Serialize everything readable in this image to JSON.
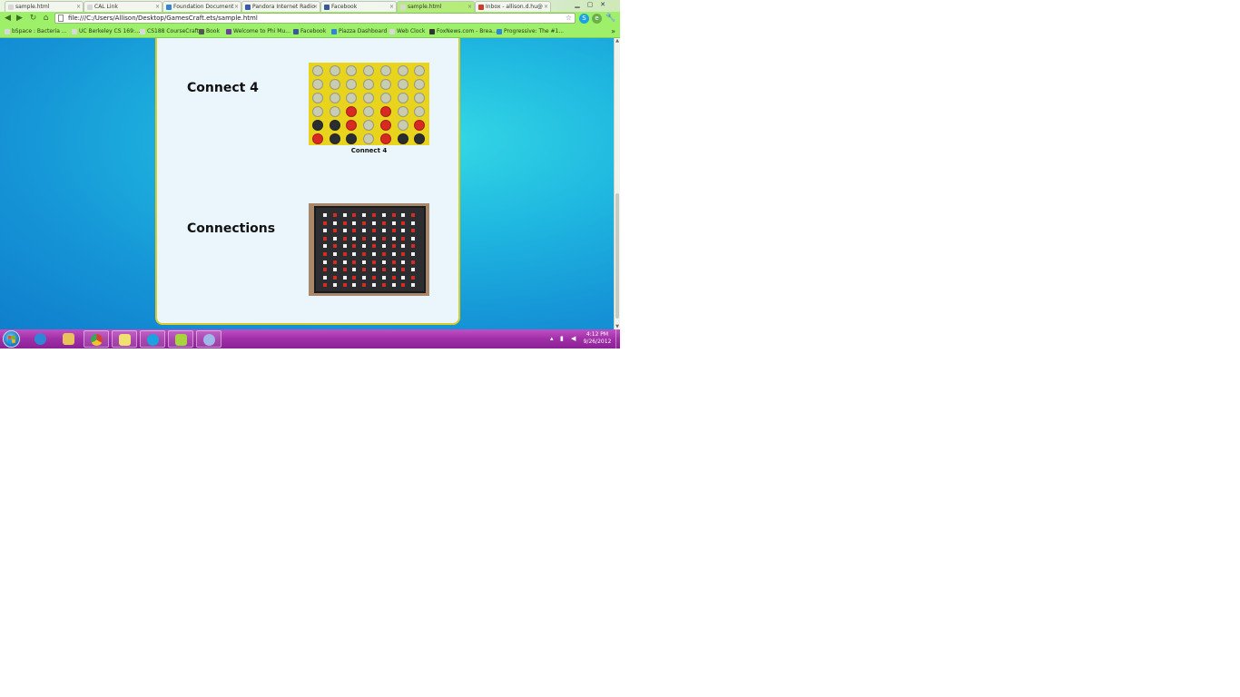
{
  "browser": {
    "tabs": [
      {
        "label": "sample.html",
        "icon_color": "#d8d8d8",
        "active": false
      },
      {
        "label": "CAL Link",
        "icon_color": "#d8d8d8",
        "active": false
      },
      {
        "label": "Foundation Document",
        "icon_color": "#2f86d6",
        "active": false
      },
      {
        "label": "Pandora Internet Radio",
        "icon_color": "#3a5ba8",
        "active": false
      },
      {
        "label": "Facebook",
        "icon_color": "#3b5998",
        "active": false
      },
      {
        "label": "sample.html",
        "icon_color": "#d8d8d8",
        "active": true
      },
      {
        "label": "Inbox - allison.d.hu@",
        "icon_color": "#d23a2a",
        "active": false
      }
    ],
    "address": "file:///C:/Users/Allison/Desktop/GamesCraft.ets/sample.html",
    "window_controls": [
      "minimize",
      "maximize",
      "close"
    ],
    "bookmarks": [
      {
        "label": "bSpace : Bacteria ...",
        "icon_color": "#d8d8d8"
      },
      {
        "label": "UC Berkeley CS 169:...",
        "icon_color": "#d8d8d8"
      },
      {
        "label": "CS188 CourseCraft",
        "icon_color": "#d8d8d8"
      },
      {
        "label": "Book",
        "icon_color": "#555555"
      },
      {
        "label": "Welcome to Phi Mu...",
        "icon_color": "#6a3fa0"
      },
      {
        "label": "Facebook",
        "icon_color": "#3b5998"
      },
      {
        "label": "Piazza Dashboard",
        "icon_color": "#2f86d6"
      },
      {
        "label": "Web Clock",
        "icon_color": "#d8d8d8"
      },
      {
        "label": "FoxNews.com - Brea...",
        "icon_color": "#333333"
      },
      {
        "label": "Progressive: The #1...",
        "icon_color": "#2f86d6"
      }
    ],
    "bookmarks_more": "»"
  },
  "page": {
    "games": [
      {
        "title": "Connect 4",
        "image_caption": "Connect 4"
      },
      {
        "title": "Connections",
        "image_caption": ""
      }
    ],
    "connect4_grid": [
      [
        "Y",
        "Y",
        "Y",
        "Y",
        "Y",
        "Y",
        "Y"
      ],
      [
        "Y",
        "Y",
        "Y",
        "Y",
        "Y",
        "Y",
        "Y"
      ],
      [
        "Y",
        "Y",
        "Y",
        "Y",
        "Y",
        "Y",
        "Y"
      ],
      [
        "Y",
        "Y",
        "R",
        "Y",
        "R",
        "Y",
        "Y"
      ],
      [
        "B",
        "B",
        "R",
        "Y",
        "R",
        "Y",
        "R"
      ],
      [
        "R",
        "B",
        "B",
        "Y",
        "R",
        "B",
        "B"
      ]
    ],
    "colors": {
      "panel_border": "#d8cc28",
      "panel_bg": "#eaf6fb",
      "board_yellow": "#e8d41c",
      "disc_red": "#d82a22",
      "disc_black": "#2a2e33",
      "empty_hole": "#c9ccb0"
    }
  },
  "taskbar": {
    "start_icon": "windows-start-icon",
    "apps": [
      {
        "name": "internet-explorer-icon",
        "color": "#2f86d6",
        "open": false
      },
      {
        "name": "file-explorer-icon",
        "color": "#e8c25a",
        "open": false
      },
      {
        "name": "chrome-icon",
        "color": "#d8412f",
        "open": true
      },
      {
        "name": "sticky-notes-icon",
        "color": "#f0e070",
        "open": true
      },
      {
        "name": "skype-icon",
        "color": "#1aa3e0",
        "open": true
      },
      {
        "name": "notepad-icon",
        "color": "#a6d43a",
        "open": true
      },
      {
        "name": "paint-icon",
        "color": "#9fb8e8",
        "open": true
      }
    ],
    "clock_time": "4:12 PM",
    "clock_date": "9/26/2012"
  }
}
